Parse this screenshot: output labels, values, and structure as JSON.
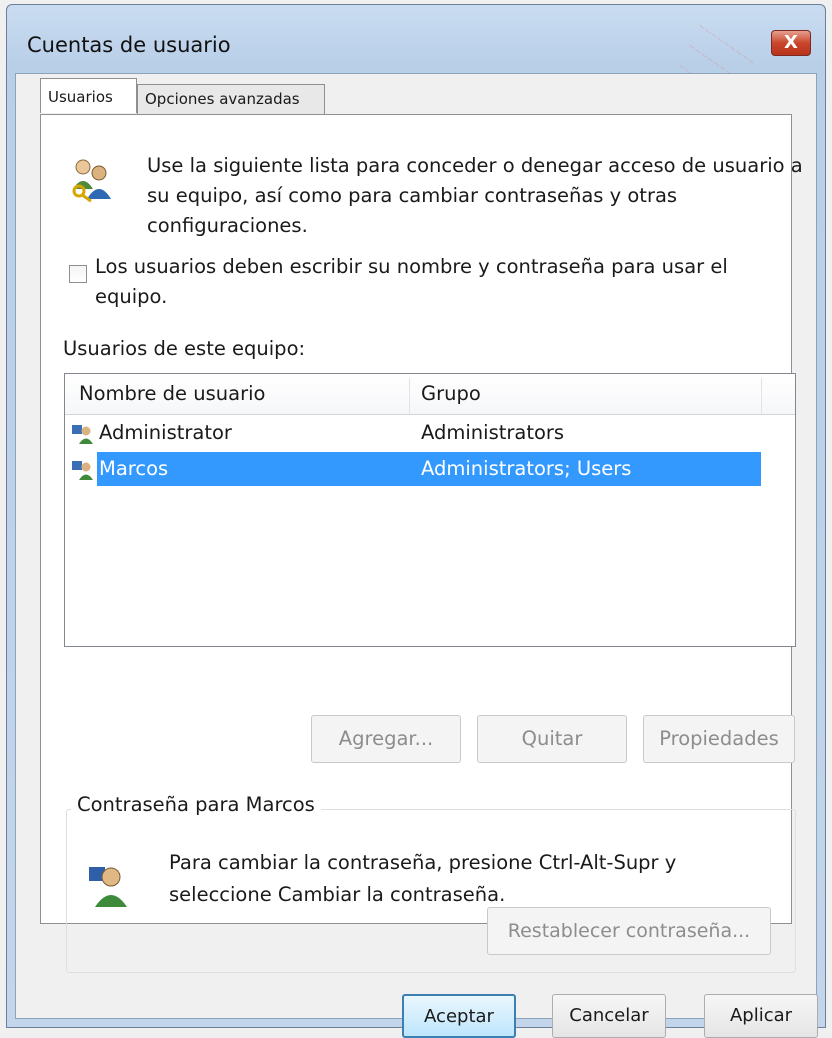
{
  "window": {
    "title": "Cuentas de usuario",
    "close_glyph": "X"
  },
  "tabs": [
    {
      "label": "Usuarios",
      "active": true
    },
    {
      "label": "Opciones avanzadas",
      "active": false
    }
  ],
  "intro": {
    "icon": "users-keys-icon",
    "text": "Use la siguiente lista para conceder o denegar acceso de usuario a su equipo, así como para cambiar contraseñas y otras configuraciones."
  },
  "require_login": {
    "label": "Los usuarios deben escribir su nombre y contraseña para usar el equipo.",
    "checked": false
  },
  "users_list": {
    "label": "Usuarios de este equipo:",
    "columns": [
      "Nombre de usuario",
      "Grupo"
    ],
    "rows": [
      {
        "name": "Administrator",
        "group": "Administrators",
        "selected": false,
        "icon": "user-account-icon"
      },
      {
        "name": "Marcos",
        "group": "Administrators; Users",
        "selected": true,
        "icon": "user-account-icon"
      }
    ]
  },
  "list_buttons": {
    "add": "Agregar...",
    "remove": "Quitar",
    "properties": "Propiedades"
  },
  "password_group": {
    "title": "Contraseña para Marcos",
    "icon": "user-password-icon",
    "text": "Para cambiar la contraseña, presione Ctrl-Alt-Supr y seleccione Cambiar la contraseña.",
    "reset_button": "Restablecer contraseña..."
  },
  "dialog_buttons": {
    "ok": "Aceptar",
    "cancel": "Cancelar",
    "apply": "Aplicar"
  },
  "colors": {
    "selection": "#3399ff",
    "title_gradient": "#c9dcf1",
    "close_button": "#c9462c"
  }
}
